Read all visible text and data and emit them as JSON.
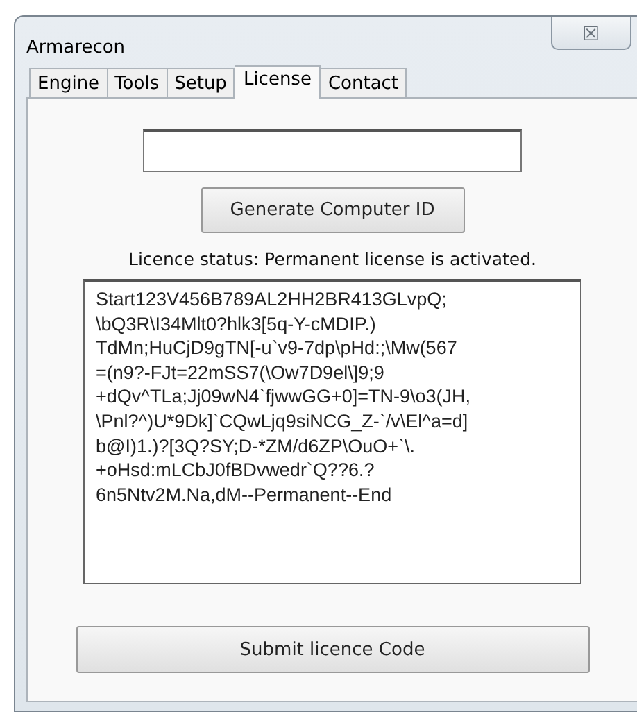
{
  "window": {
    "title": "Armarecon",
    "close_label": "☒"
  },
  "tabs": [
    {
      "label": "Engine",
      "selected": false
    },
    {
      "label": "Tools",
      "selected": false
    },
    {
      "label": "Setup",
      "selected": false
    },
    {
      "label": "License",
      "selected": true
    },
    {
      "label": "Contact",
      "selected": false
    }
  ],
  "generate_button": "Generate Computer ID",
  "status": "Licence status: Permanent license is activated.",
  "license_code": [
    "Start123V456B789AL2HH2BR413GLvpQ;",
    "\\bQ3R\\I34Mlt0?hlk3[5q-Y-cMDIP.)",
    "TdMn;HuCjD9gTN[-u`v9-7dp\\pHd:;\\Mw(567",
    "=(n9?-FJt=22mSS7(\\Ow7D9el\\]9;9",
    "+dQv^TLa;Jj09wN4`fjwwGG+0]=TN-9\\o3(JH,",
    "\\Pnl?^)U*9Dk]`CQwLjq9siNCG_Z-`/v\\El^a=d]",
    "b@I)1.)?[3Q?SY;D-*ZM/d6ZP\\OuO+`\\.",
    "+oHsd:mLCbJ0fBDvwedr`Q??6.?",
    "6n5Ntv2M.Na,dM--Permanent--End"
  ],
  "submit_button": "Submit licence Code"
}
